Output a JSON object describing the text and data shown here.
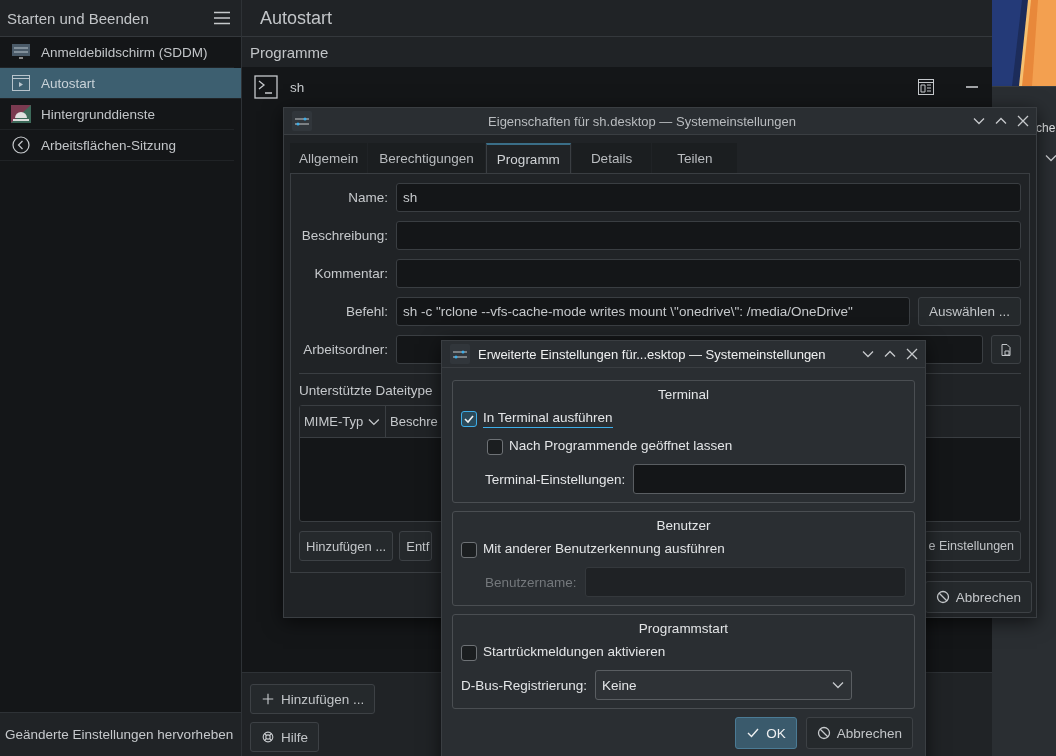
{
  "sidebar": {
    "title": "Starten und Beenden",
    "items": [
      {
        "label": "Anmeldebildschirm (SDDM)",
        "selected": false
      },
      {
        "label": "Autostart",
        "selected": true
      },
      {
        "label": "Hintergrunddienste",
        "selected": false
      },
      {
        "label": "Arbeitsflächen-Sitzung",
        "selected": false
      }
    ],
    "footer": "Geänderte Einstellungen hervorheben"
  },
  "main": {
    "title": "Autostart",
    "section": "Programme",
    "entries": [
      {
        "name": "sh"
      }
    ],
    "buttons": [
      "Hinzufügen ...",
      "Hilfe"
    ]
  },
  "background_window": {
    "text": "che"
  },
  "properties_dialog": {
    "title": "Eigenschaften für sh.desktop — Systemeinstellungen",
    "tabs": [
      {
        "label": "Allgemein",
        "selected": false
      },
      {
        "label": "Berechtigungen",
        "selected": false
      },
      {
        "label": "Programm",
        "selected": true
      },
      {
        "label": "Details",
        "selected": false
      },
      {
        "label": "Teilen",
        "selected": false
      }
    ],
    "fields": [
      {
        "kind": "plain",
        "label": "Name:",
        "value": "sh"
      },
      {
        "kind": "plain",
        "label": "Beschreibung:"
      },
      {
        "kind": "plain",
        "label": "Kommentar:"
      },
      {
        "kind": "command",
        "label": "Befehl:",
        "value": "sh -c \"rclone --vfs-cache-mode writes mount \\\"onedrive\\\": /media/OneDrive\"",
        "button": "Auswählen ..."
      },
      {
        "kind": "folder",
        "label": "Arbeitsordner:"
      }
    ],
    "filetypes": {
      "label": "Unterstützte Dateitype",
      "columns": [
        "MIME-Typ",
        "Beschre"
      ],
      "buttons": [
        "Hinzufügen ...",
        "Entf",
        "e Einstellungen"
      ]
    },
    "footer_buttons": [
      "Abbrechen"
    ]
  },
  "advanced_dialog": {
    "title": "Erweiterte Einstellungen für...esktop — Systemeinstellungen",
    "groups": [
      {
        "title": "Terminal",
        "rows": [
          {
            "kind": "checkbox",
            "label": "In Terminal ausführen",
            "checked": true,
            "focused": true,
            "children": [
              {
                "kind": "checkbox",
                "label": "Nach Programmende geöffnet lassen",
                "checked": false,
                "focused": false
              }
            ]
          },
          {
            "kind": "field",
            "label": "Terminal-Einstellungen:",
            "disabled": false
          }
        ]
      },
      {
        "title": "Benutzer",
        "rows": [
          {
            "kind": "checkbox",
            "label": "Mit anderer Benutzerkennung ausführen",
            "checked": false,
            "focused": false
          },
          {
            "kind": "field",
            "label": "Benutzername:",
            "disabled": true
          }
        ]
      },
      {
        "title": "Programmstart",
        "rows": [
          {
            "kind": "checkbox",
            "label": "Startrückmeldungen aktivieren",
            "checked": false,
            "focused": false
          },
          {
            "kind": "select",
            "label": "D-Bus-Registrierung:",
            "value": "Keine"
          }
        ]
      }
    ],
    "buttons": [
      {
        "label": "OK",
        "default": true
      },
      {
        "label": "Abbrechen",
        "default": false
      }
    ]
  }
}
